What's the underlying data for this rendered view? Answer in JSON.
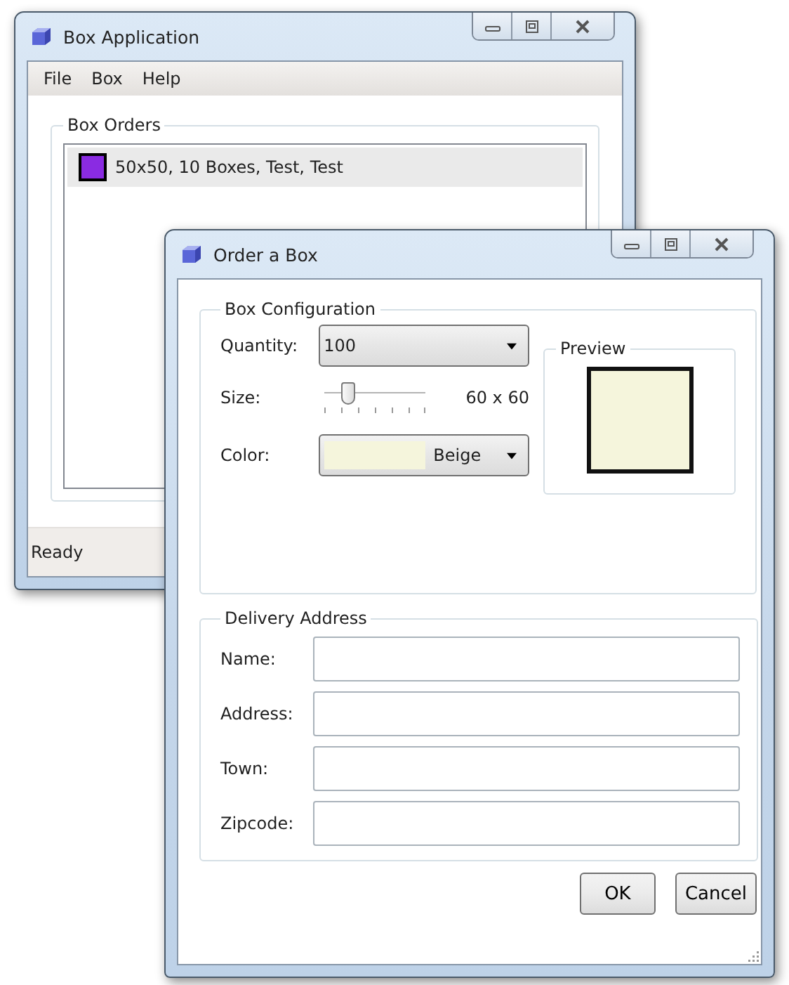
{
  "main_window": {
    "title": "Box Application",
    "menu": [
      "File",
      "Box",
      "Help"
    ],
    "orders_group": {
      "title": "Box Orders",
      "items": [
        {
          "label": "50x50, 10 Boxes, Test, Test",
          "color": "#8a2be2",
          "selected": true
        }
      ]
    },
    "status_bar": "Ready"
  },
  "dialog": {
    "title": "Order a Box",
    "config_group": {
      "title": "Box Configuration",
      "quantity": {
        "label": "Quantity:",
        "value": "100"
      },
      "size": {
        "label": "Size:",
        "level": 0.23,
        "reading": "60 x 60"
      },
      "color": {
        "label": "Color:",
        "value": "Beige",
        "color": "#f5f5dc"
      },
      "preview": {
        "title": "Preview"
      }
    },
    "address_group": {
      "title": "Delivery Address",
      "fields": [
        {
          "label": "Name:"
        },
        {
          "label": "Address:"
        },
        {
          "label": "Town:"
        },
        {
          "label": "Zipcode:"
        }
      ]
    },
    "buttons": [
      "OK",
      "Cancel"
    ]
  }
}
